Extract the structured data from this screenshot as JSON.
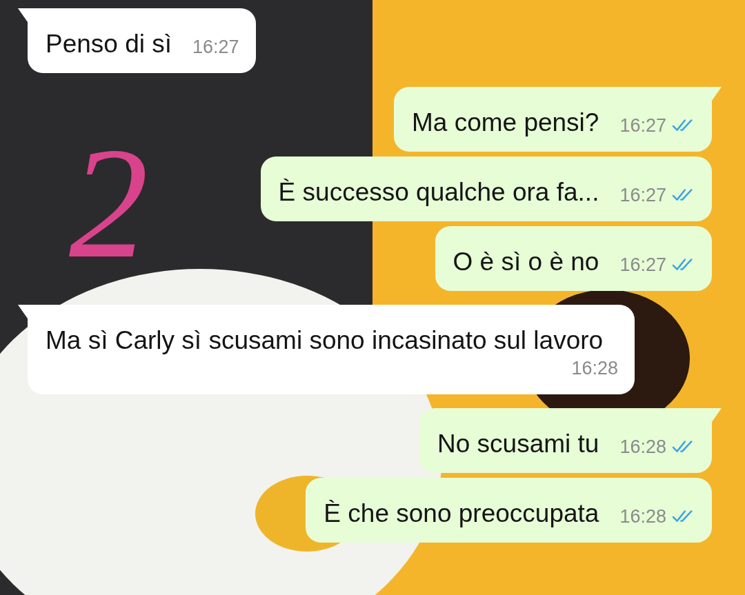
{
  "annotation": "2",
  "messages": [
    {
      "kind": "incoming",
      "text": "Penso di sì",
      "time": "16:27",
      "tail": true
    },
    {
      "kind": "outgoing",
      "text": "Ma come pensi?",
      "time": "16:27",
      "tail": true,
      "read": true
    },
    {
      "kind": "outgoing",
      "text": "È successo qualche ora fa...",
      "time": "16:27",
      "tail": false,
      "read": true
    },
    {
      "kind": "outgoing",
      "text": "O è sì o è no",
      "time": "16:27",
      "tail": false,
      "read": true
    },
    {
      "kind": "incoming",
      "text": "Ma sì Carly sì scusami sono incasinato sul lavoro",
      "time": "16:28",
      "tail": true
    },
    {
      "kind": "outgoing",
      "text": "No scusami tu",
      "time": "16:28",
      "tail": true,
      "read": true
    },
    {
      "kind": "outgoing",
      "text": "È che sono preoccupata",
      "time": "16:28",
      "tail": false,
      "read": true
    }
  ]
}
